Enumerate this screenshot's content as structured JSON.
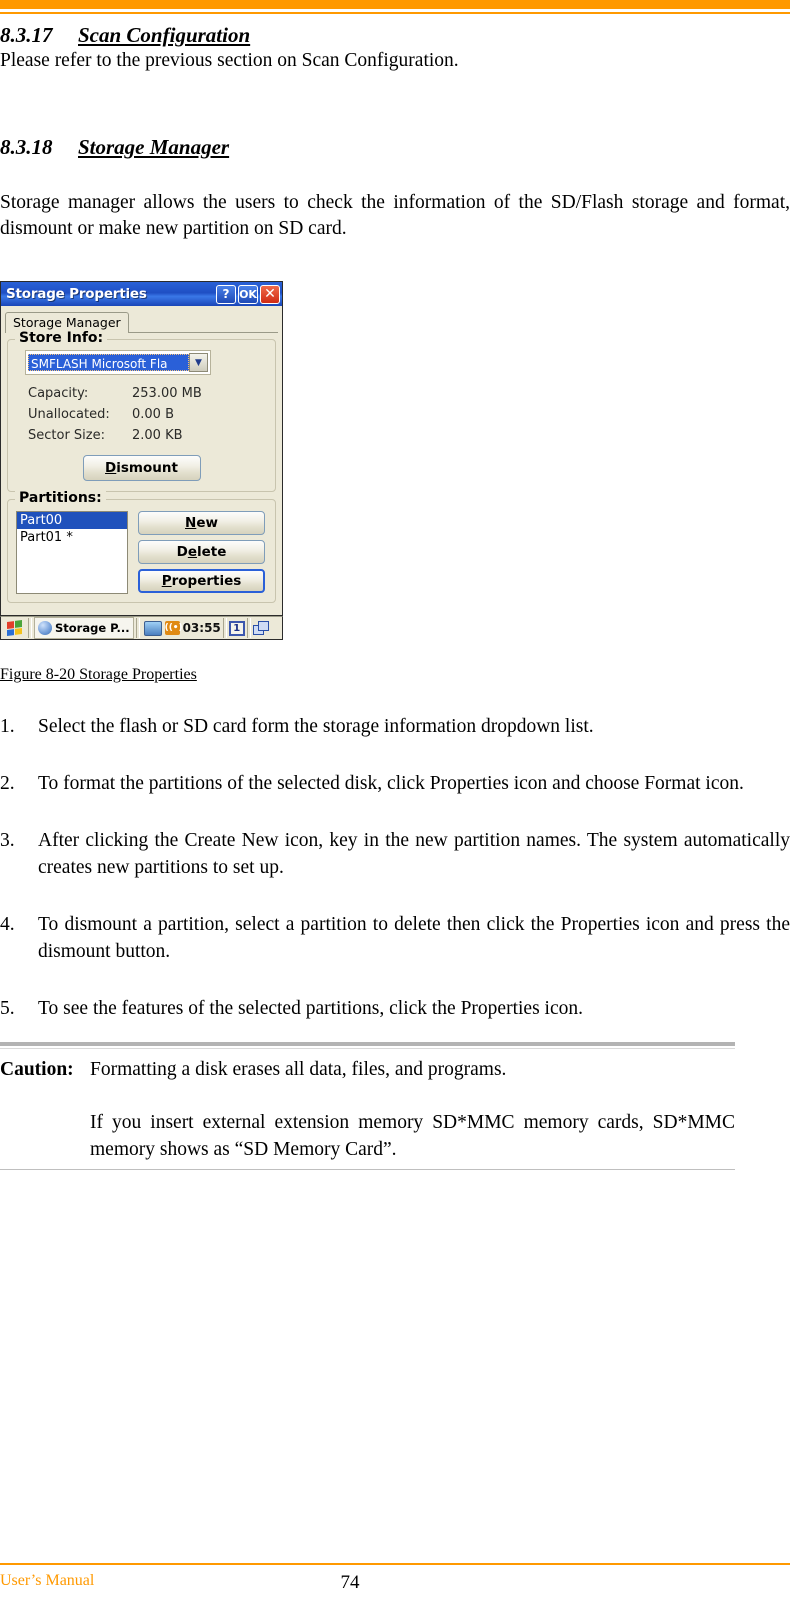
{
  "document": {
    "heading_1": {
      "number": "8.3.17",
      "title": "Scan Configuration"
    },
    "paragraph_1": "Please refer to the previous section on Scan Configuration.",
    "heading_2": {
      "number": "8.3.18",
      "title": "Storage Manager"
    },
    "paragraph_2": "Storage manager allows the users to check the information of the SD/Flash storage and format, dismount or make new partition on SD card.",
    "figure_caption": "Figure 8-20 Storage Properties",
    "steps": [
      {
        "number": "1.",
        "text": "Select the flash or SD card form the storage information dropdown list."
      },
      {
        "number": "2.",
        "text": "To format the partitions of the selected disk, click Properties icon and choose Format icon."
      },
      {
        "number": "3.",
        "text": "After clicking the Create New icon, key in the new partition names. The system automatically creates new partitions to set up."
      },
      {
        "number": "4.",
        "text": "To dismount a partition, select a partition to delete then click the Properties icon and press the dismount button."
      },
      {
        "number": "5.",
        "text": "To see the features of the selected partitions, click the Properties icon."
      }
    ],
    "caution": {
      "label": "Caution:",
      "line_1": "Formatting a disk erases all data, files, and programs.",
      "line_2": "If you insert external extension memory SD*MMC memory cards, SD*MMC memory shows as “SD Memory Card”."
    },
    "footer": {
      "left": "User’s Manual",
      "page_number": "74"
    },
    "accent_color": "#FF9900"
  },
  "dialog": {
    "title": "Storage Properties",
    "titlebar_buttons": [
      {
        "name": "help",
        "label": "?"
      },
      {
        "name": "ok",
        "label": "OK"
      },
      {
        "name": "close",
        "label": "✕"
      }
    ],
    "tab": "Storage Manager",
    "store_info": {
      "group_label": "Store Info:",
      "selected_device": "SMFLASH Microsoft Fla",
      "rows": [
        {
          "label": "Capacity:",
          "value": "253.00 MB"
        },
        {
          "label": "Unallocated:",
          "value": "0.00 B"
        },
        {
          "label": "Sector Size:",
          "value": "2.00 KB"
        }
      ],
      "dismount_button": {
        "accel": "D",
        "rest": "ismount"
      }
    },
    "partitions": {
      "group_label": "Partitions:",
      "items": [
        {
          "label": "Part00",
          "selected": true
        },
        {
          "label": "Part01 *",
          "selected": false
        }
      ],
      "buttons": [
        {
          "accel": "N",
          "rest": "ew",
          "focused": false
        },
        {
          "accel": "D",
          "pre": "",
          "mid": "e",
          "rest": "lete",
          "focused": false
        },
        {
          "accel": "P",
          "rest": "roperties",
          "focused": true
        }
      ]
    },
    "taskbar": {
      "start_label": "start",
      "task_label": "Storage P...",
      "time": "03:55",
      "tray_box_label": "1"
    },
    "colors": {
      "titlebar": "#1f4fc4",
      "close_button": "#cf2a13",
      "face": "#ECE9D8",
      "selection": "#1f51bc"
    }
  }
}
